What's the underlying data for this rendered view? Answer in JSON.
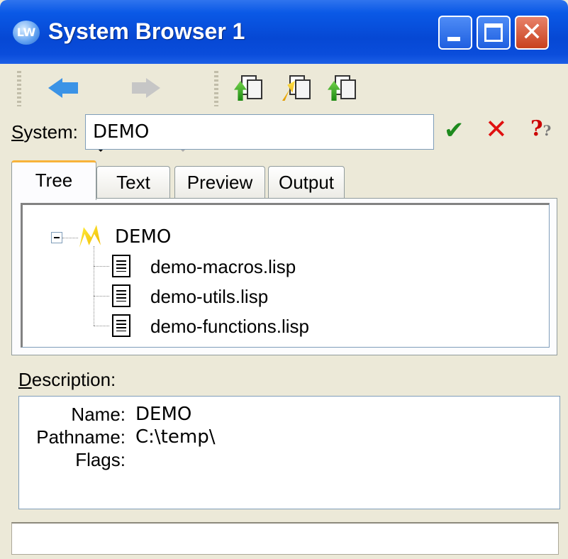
{
  "window": {
    "title": "System Browser 1",
    "app_icon_text": "LW"
  },
  "toolbar": {
    "items": [
      {
        "name": "back-button",
        "icon": "back-arrow-icon",
        "enabled": true
      },
      {
        "name": "forward-button",
        "icon": "forward-arrow-icon",
        "enabled": false
      },
      {
        "name": "system-op-1",
        "icon": "system-load-icon"
      },
      {
        "name": "system-op-2",
        "icon": "system-compile-icon"
      },
      {
        "name": "system-op-3",
        "icon": "system-files-icon"
      }
    ]
  },
  "system_field": {
    "label_accel": "S",
    "label_rest": "ystem:",
    "value": "DEMO"
  },
  "actions": {
    "ok_glyph": "✔",
    "cancel_glyph": "✕",
    "help_glyph": "?"
  },
  "tabs": [
    {
      "label": "Tree",
      "active": true
    },
    {
      "label": "Text",
      "active": false
    },
    {
      "label": "Preview",
      "active": false
    },
    {
      "label": "Output",
      "active": false
    }
  ],
  "tree": {
    "root": "DEMO",
    "children": [
      "demo-macros.lisp",
      "demo-utils.lisp",
      "demo-functions.lisp"
    ]
  },
  "description": {
    "label_accel": "D",
    "label_rest": "escription:",
    "rows": [
      {
        "key": "Name:",
        "value": "DEMO"
      },
      {
        "key": "Pathname:",
        "value": "C:\\temp\\"
      },
      {
        "key": "Flags:",
        "value": ""
      }
    ]
  },
  "colors": {
    "titlebar": "#0648d4",
    "ok": "#1e8a1e",
    "cancel": "#e01010",
    "tab_highlight": "#f8b33a"
  }
}
